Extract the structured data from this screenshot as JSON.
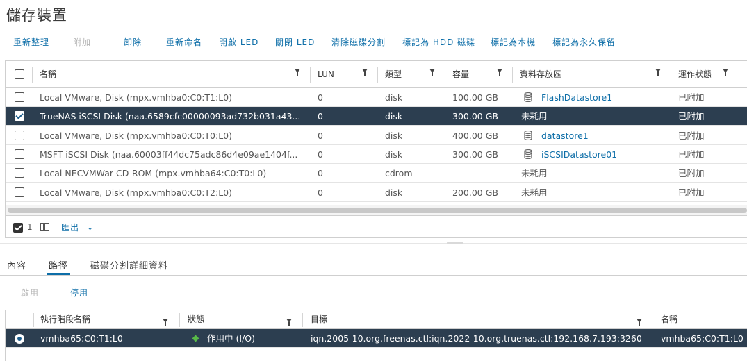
{
  "page": {
    "title": "儲存裝置"
  },
  "toolbar": {
    "rescan": "重新整理",
    "attach": "附加",
    "detach": "卸除",
    "rename": "重新命名",
    "led_on": "開啟 LED",
    "led_off": "關閉 LED",
    "erase_partitions": "清除磁碟分割",
    "mark_hdd": "標記為 HDD 磁碟",
    "mark_local": "標記為本機",
    "mark_perennial": "標記為永久保留"
  },
  "devices_table": {
    "columns": {
      "name": "名稱",
      "lun": "LUN",
      "type": "類型",
      "capacity": "容量",
      "datastore": "資料存放區",
      "operational_state": "運作狀態"
    },
    "rows": [
      {
        "name": "Local VMware, Disk (mpx.vmhba0:C0:T1:L0)",
        "lun": "0",
        "type": "disk",
        "capacity": "100.00 GB",
        "datastore": "FlashDatastore1",
        "datastore_icon": true,
        "state": "已附加",
        "selected": false
      },
      {
        "name": "TrueNAS iSCSI Disk (naa.6589cfc00000093ad732b031a43...",
        "lun": "0",
        "type": "disk",
        "capacity": "300.00 GB",
        "datastore": "未耗用",
        "datastore_icon": false,
        "state": "已附加",
        "selected": true
      },
      {
        "name": "Local VMware, Disk (mpx.vmhba0:C0:T0:L0)",
        "lun": "0",
        "type": "disk",
        "capacity": "400.00 GB",
        "datastore": "datastore1",
        "datastore_icon": true,
        "state": "已附加",
        "selected": false
      },
      {
        "name": "MSFT iSCSI Disk (naa.60003ff44dc75adc86d4e09ae1404f...",
        "lun": "0",
        "type": "disk",
        "capacity": "300.00 GB",
        "datastore": "iSCSIDatastore01",
        "datastore_icon": true,
        "state": "已附加",
        "selected": false
      },
      {
        "name": "Local NECVMWar CD-ROM (mpx.vmhba64:C0:T0:L0)",
        "lun": "0",
        "type": "cdrom",
        "capacity": "",
        "datastore": "未耗用",
        "datastore_icon": false,
        "state": "已附加",
        "selected": false
      },
      {
        "name": "Local VMware, Disk (mpx.vmhba0:C0:T2:L0)",
        "lun": "0",
        "type": "disk",
        "capacity": "200.00 GB",
        "datastore": "未耗用",
        "datastore_icon": false,
        "state": "已附加",
        "selected": false
      }
    ],
    "footer": {
      "selected_count": "1",
      "export_label": "匯出"
    }
  },
  "detail_tabs": {
    "properties": "內容",
    "paths": "路徑",
    "partition_details": "磁碟分割詳細資料"
  },
  "paths_toolbar": {
    "enable": "啟用",
    "disable": "停用"
  },
  "paths_table": {
    "columns": {
      "runtime_name": "執行階段名稱",
      "status": "狀態",
      "target": "目標",
      "name": "名稱"
    },
    "rows": [
      {
        "runtime_name": "vmhba65:C0:T1:L0",
        "status": "作用中 (I/O)",
        "target": "iqn.2005-10.org.freenas.ctl:iqn.2022-10.org.truenas.ctl:192.168.7.193:3260",
        "name": "vmhba65:C0:T1:L0"
      }
    ]
  },
  "colors": {
    "accent": "#0d6ea8",
    "selected_row": "#2c3e50",
    "status_active": "#58b947"
  }
}
